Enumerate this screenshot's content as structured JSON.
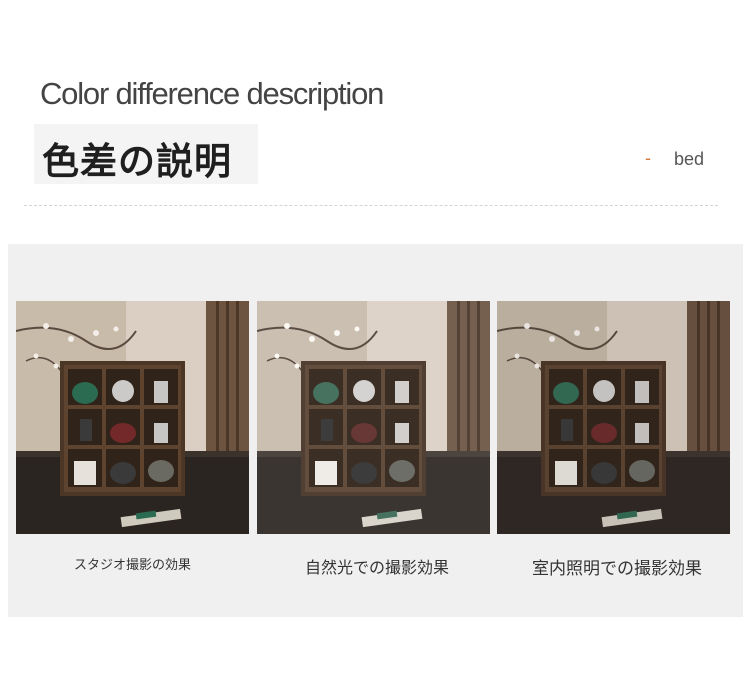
{
  "header": {
    "title_en": "Color difference description",
    "title_jp": "色差の説明",
    "nav_dash": "-",
    "nav_label": "bed"
  },
  "photos": [
    {
      "caption": "スタジオ撮影の効果"
    },
    {
      "caption": "自然光での撮影効果"
    },
    {
      "caption": "室内照明での撮影効果"
    }
  ]
}
